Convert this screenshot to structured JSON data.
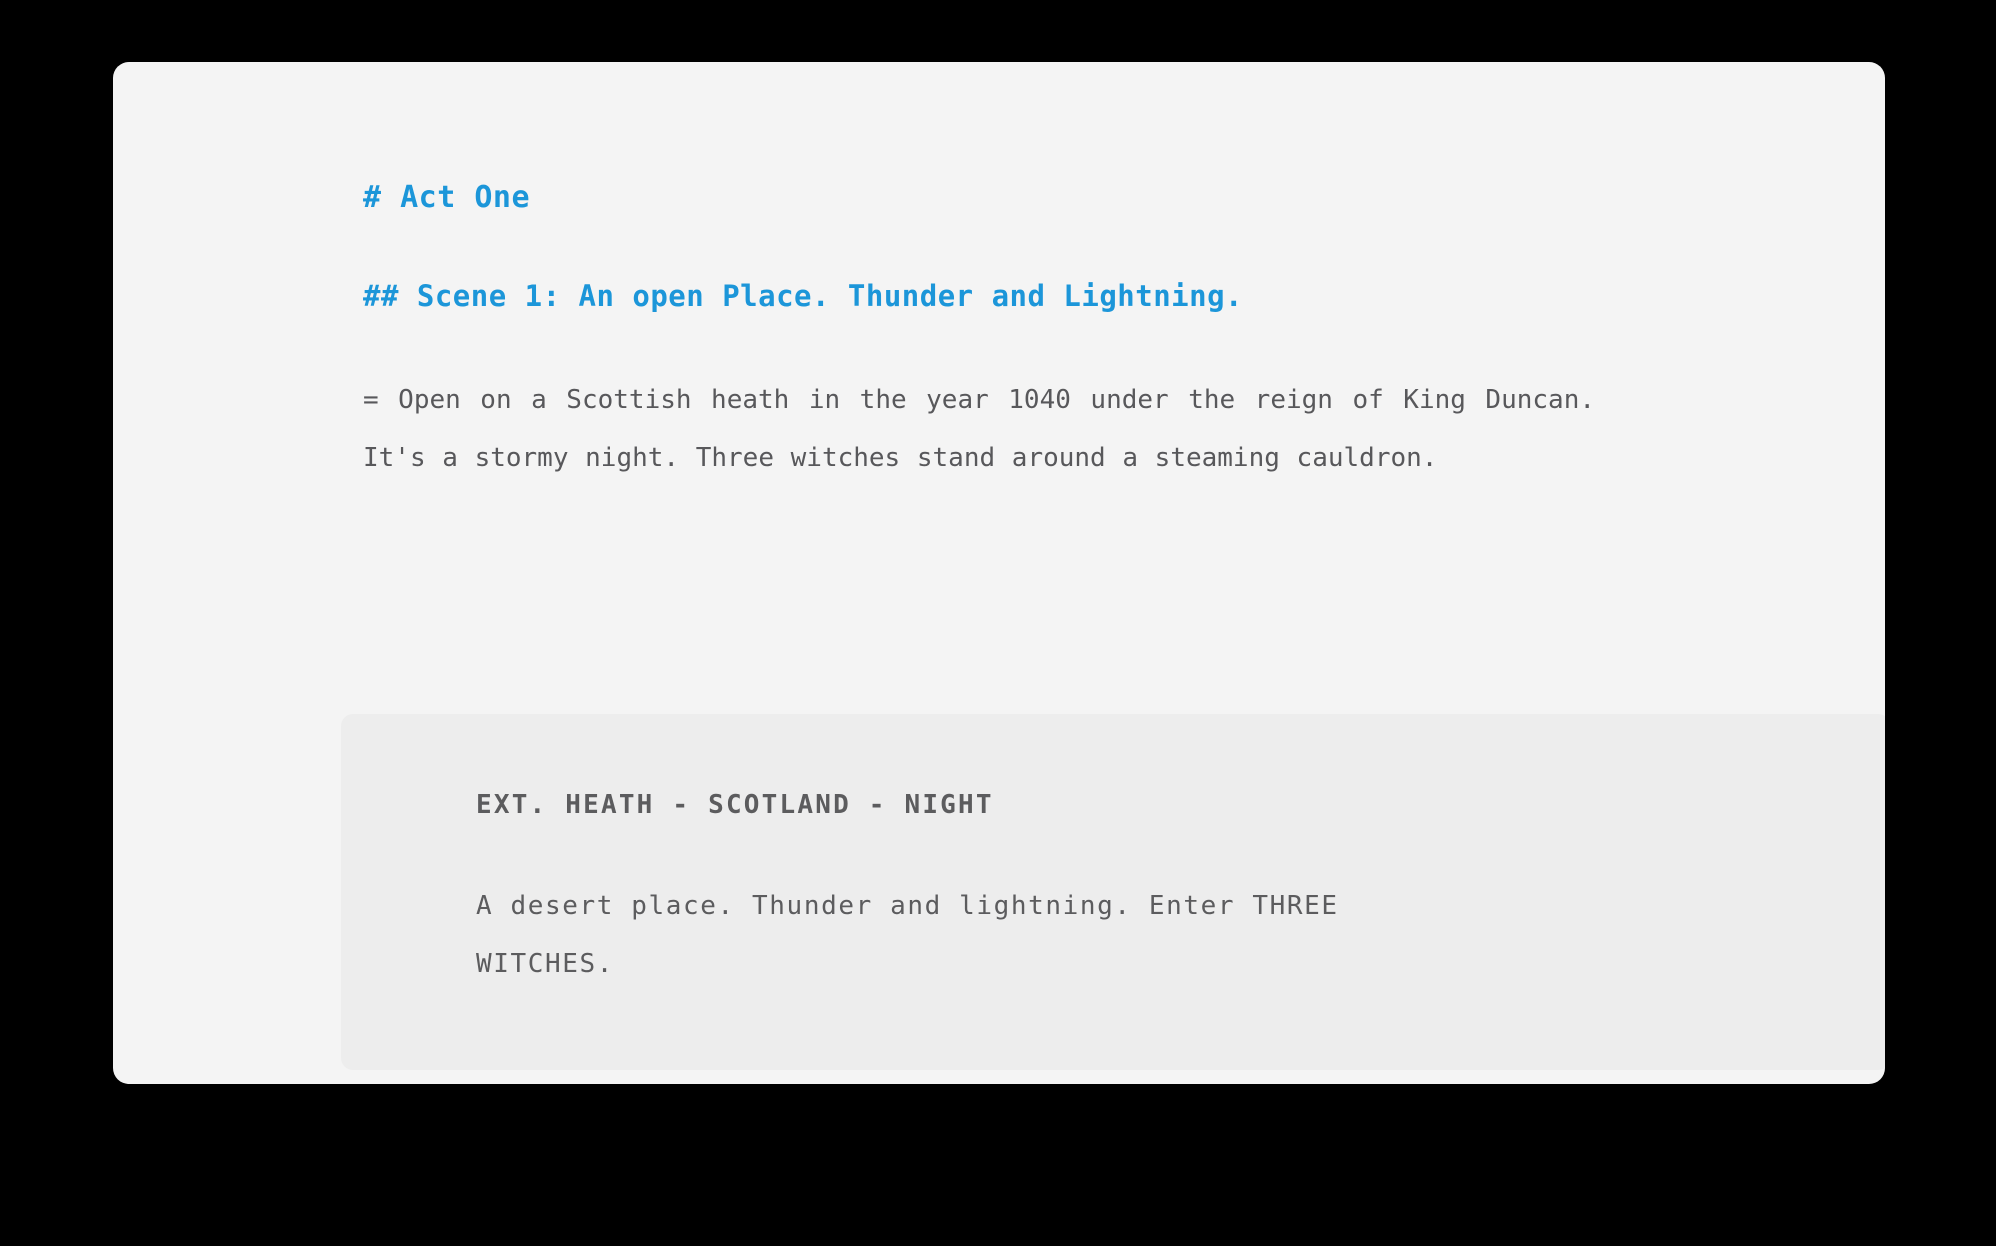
{
  "page": {
    "background_color": "#000000",
    "card_background_color": "#f4f4f4",
    "accent_color": "#1c96d9",
    "body_text_color": "#58585b",
    "code_block_background_color": "#ededed",
    "code_text_color": "#5c5c5e"
  },
  "document": {
    "act_heading": "# Act One",
    "scene_heading": "## Scene 1: An open Place. Thunder and Lightning.",
    "description_paragraph": "= Open on a Scottish heath in the year 1040 under the reign of King Duncan. It's a stormy night. Three witches stand around a steaming cauldron.",
    "screenplay_block": {
      "slugline": "EXT. HEATH - SCOTLAND - NIGHT",
      "action": "A desert place. Thunder and lightning. Enter THREE WITCHES."
    }
  }
}
